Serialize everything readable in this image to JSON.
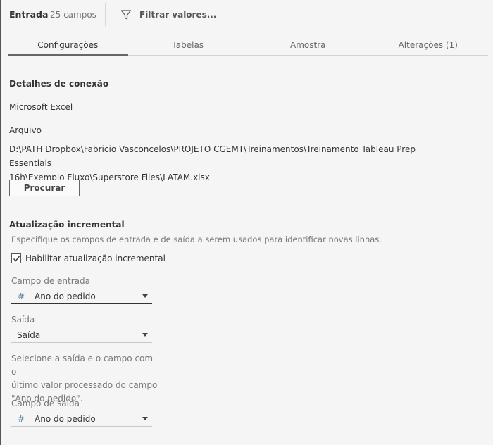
{
  "header": {
    "title": "Entrada",
    "field_count": "25 campos",
    "filter_label": "Filtrar valores..."
  },
  "tabs": [
    {
      "label": "Configurações",
      "active": true
    },
    {
      "label": "Tabelas",
      "active": false
    },
    {
      "label": "Amostra",
      "active": false
    },
    {
      "label": "Alterações (1)",
      "active": false
    }
  ],
  "connection": {
    "heading": "Detalhes de conexão",
    "type": "Microsoft Excel",
    "file_label": "Arquivo",
    "file_path_line1": "D:\\PATH Dropbox\\Fabricio Vasconcelos\\PROJETO CGEMT\\Treinamentos\\Treinamento Tableau Prep Essentials",
    "file_path_line2": "16h\\Exemplo Fluxo\\Superstore Files\\LATAM.xlsx",
    "browse_label": "Procurar"
  },
  "incremental": {
    "heading": "Atualização incremental",
    "hint": "Especifique os campos de entrada e de saída a serem usados para identificar novas linhas.",
    "enable_label": "Habilitar atualização incremental",
    "enabled": true,
    "input_field_label": "Campo de entrada",
    "input_field_value": "Ano do pedido",
    "output_label": "Saída",
    "output_value": "Saída",
    "description_line1": "Selecione a saída e o campo com o",
    "description_line2": "último valor processado do campo",
    "description_line3": "\"Ano do pedido\".",
    "output_field_label": "Campo de saída",
    "output_field_value": "Ano do pedido"
  },
  "icons": {
    "filter": "funnel-icon",
    "number_field": "hash-icon",
    "dropdown": "caret-down-icon",
    "checkbox": "check-icon"
  },
  "colors": {
    "background": "#f5f5f5",
    "hash_icon": "#4a7c9b",
    "active_tab_underline": "#666666"
  }
}
